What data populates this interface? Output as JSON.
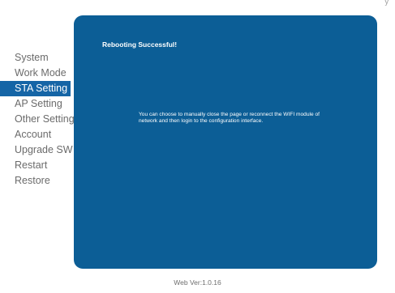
{
  "header": {
    "stub_text": "y"
  },
  "sidebar": {
    "items": [
      {
        "label": "System",
        "active": false
      },
      {
        "label": "Work Mode",
        "active": false
      },
      {
        "label": "STA Setting",
        "active": true
      },
      {
        "label": "AP Setting",
        "active": false
      },
      {
        "label": "Other Setting",
        "active": false
      },
      {
        "label": "Account",
        "active": false
      },
      {
        "label": "Upgrade SW",
        "active": false
      },
      {
        "label": "Restart",
        "active": false
      },
      {
        "label": "Restore",
        "active": false
      }
    ]
  },
  "panel": {
    "title": "Rebooting Successful!",
    "message": "You can choose to manually close the page or reconnect the WIFI module of network and then login to the configuration interface."
  },
  "footer": {
    "version": "Web Ver:1.0.16"
  },
  "colors": {
    "panel_background": "#0c5e96",
    "active_nav_background": "#1565a6",
    "nav_text": "#6b6b6b"
  }
}
